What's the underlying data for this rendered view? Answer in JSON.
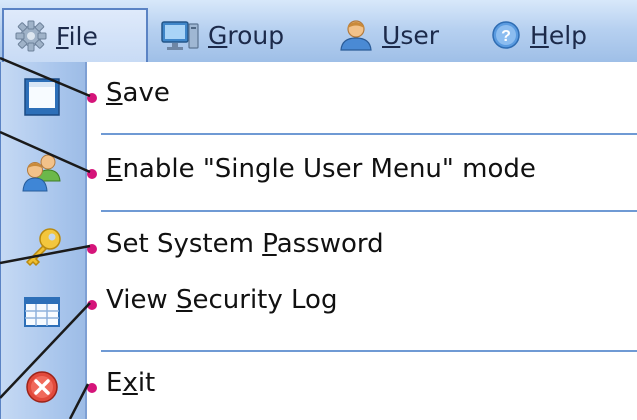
{
  "menubar": {
    "items": [
      {
        "pre": "",
        "key": "F",
        "post": "ile",
        "icon": "gear-icon"
      },
      {
        "pre": "",
        "key": "G",
        "post": "roup",
        "icon": "monitor-icon"
      },
      {
        "pre": "",
        "key": "U",
        "post": "ser",
        "icon": "user-icon"
      },
      {
        "pre": "",
        "key": "H",
        "post": "elp",
        "icon": "help-icon"
      }
    ]
  },
  "file_menu": {
    "items": [
      {
        "pre": "",
        "key": "S",
        "post": "ave",
        "icon": "save-icon"
      },
      {
        "pre": "",
        "key": "E",
        "post": "nable \"Single User Menu\" mode",
        "icon": "users-icon"
      },
      {
        "pre": "Set System ",
        "key": "P",
        "post": "assword",
        "icon": "key-icon"
      },
      {
        "pre": "View ",
        "key": "S",
        "post": "ecurity Log",
        "icon": "log-icon"
      },
      {
        "pre": "E",
        "key": "x",
        "post": "it",
        "icon": "exit-icon"
      }
    ]
  },
  "colors": {
    "menubar_bg": "#b6d0f0",
    "gutter_bg": "#a8c5ec",
    "separator": "#6f9ad4",
    "callout": "#d5147a"
  }
}
